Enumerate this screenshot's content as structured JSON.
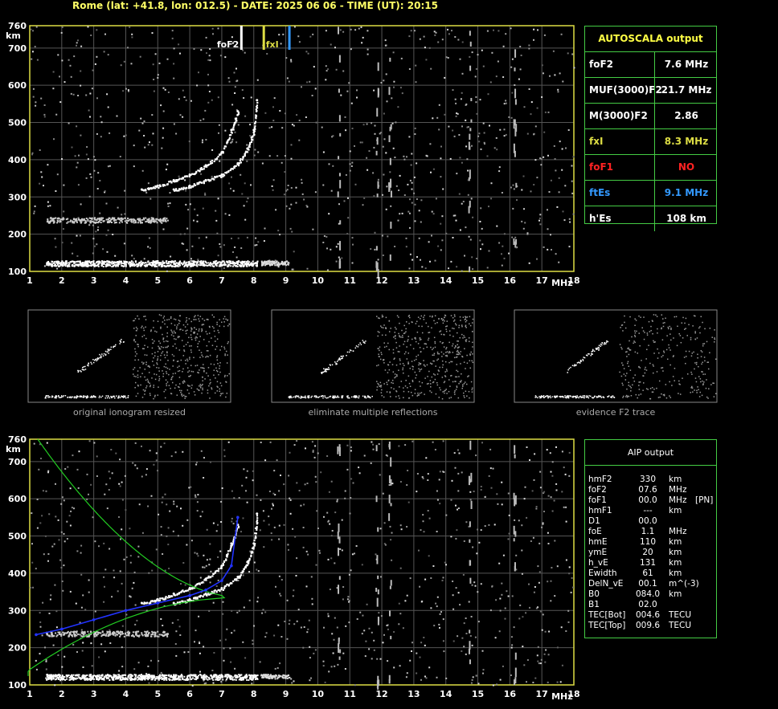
{
  "header": "Rome (lat: +41.8, lon: 012.5) - DATE: 2025 06 06 - TIME (UT): 20:15",
  "axis": {
    "y_unit": "km",
    "x_unit": "MHz",
    "y_ticks": [
      "760",
      "700",
      "600",
      "500",
      "400",
      "300",
      "200",
      "100"
    ],
    "x_ticks": [
      "1",
      "2",
      "3",
      "4",
      "5",
      "6",
      "7",
      "8",
      "9",
      "10",
      "11",
      "12",
      "13",
      "14",
      "15",
      "16",
      "17",
      "18"
    ]
  },
  "markers": {
    "fof2": "foF2",
    "fxi": "fxI",
    "ftes": "ftEs"
  },
  "autoscala": {
    "title": "AUTOSCALA output",
    "rows": [
      {
        "label": "foF2",
        "value": "7.6 MHz",
        "color": "#ffffff"
      },
      {
        "label": "MUF(3000)F2",
        "value": "21.7 MHz",
        "color": "#ffffff"
      },
      {
        "label": "M(3000)F2",
        "value": "2.86",
        "color": "#ffffff"
      },
      {
        "label": "fxI",
        "value": "8.3 MHz",
        "color": "#dddd44"
      },
      {
        "label": "foF1",
        "value": "NO",
        "color": "#ff2222"
      },
      {
        "label": "ftEs",
        "value": "9.1 MHz",
        "color": "#3399ff"
      },
      {
        "label": "h'Es",
        "value": "108    km",
        "color": "#ffffff"
      }
    ]
  },
  "thumbs": [
    {
      "caption": "original ionogram resized"
    },
    {
      "caption": "eliminate multiple reflections"
    },
    {
      "caption": "evidence F2 trace"
    }
  ],
  "aip": {
    "title": "AIP output",
    "rows": [
      [
        "hmF2",
        "330",
        "km",
        ""
      ],
      [
        "foF2",
        "07.6",
        "MHz",
        ""
      ],
      [
        "foF1",
        "00.0",
        "MHz",
        "[PN]"
      ],
      [
        "hmF1",
        "---",
        "km",
        ""
      ],
      [
        "D1",
        "00.0",
        "",
        ""
      ],
      [
        "foE",
        "1.1",
        "MHz",
        ""
      ],
      [
        "hmE",
        "110",
        "km",
        ""
      ],
      [
        "ymE",
        "20",
        "km",
        ""
      ],
      [
        "h_vE",
        "131",
        "km",
        ""
      ],
      [
        "Ewidth",
        "61",
        "km",
        ""
      ],
      [
        "DelN_vE",
        "00.1",
        "m^(-3)",
        ""
      ],
      [
        "B0",
        "084.0",
        "km",
        ""
      ],
      [
        "B1",
        "02.0",
        "",
        ""
      ],
      [
        "TEC[Bot]",
        "004.6",
        "TECU",
        ""
      ],
      [
        "TEC[Top]",
        "009.6",
        "TECU",
        ""
      ]
    ]
  },
  "chart_data": [
    {
      "type": "scatter",
      "title": "Rome (lat: +41.8, lon: 012.5) - DATE: 2025 06 06 - TIME (UT): 20:15",
      "xlabel": "MHz",
      "ylabel": "km",
      "xlim": [
        1,
        18
      ],
      "ylim": [
        100,
        760
      ],
      "grid": true,
      "series": [
        {
          "name": "",
          "x": [
            4.5,
            5.0,
            5.5,
            6.0,
            6.5,
            7.0,
            7.3,
            7.5
          ],
          "y": [
            320,
            330,
            345,
            360,
            385,
            420,
            480,
            530
          ]
        },
        {
          "name": "",
          "x": [
            5.5,
            6.0,
            6.5,
            7.0,
            7.5,
            7.8,
            8.0,
            8.1
          ],
          "y": [
            320,
            330,
            345,
            360,
            390,
            430,
            480,
            560
          ]
        }
      ]
    },
    {
      "type": "line",
      "xlabel": "MHz",
      "ylabel": "km",
      "xlim": [
        1,
        18
      ],
      "ylim": [
        100,
        760
      ],
      "grid": true,
      "series": [
        {
          "name": "",
          "x": [
            1.2,
            2,
            3,
            4,
            5,
            6,
            6.5,
            7,
            7.3,
            7.5
          ],
          "y": [
            235,
            250,
            275,
            300,
            320,
            340,
            355,
            380,
            420,
            550
          ]
        }
      ]
    }
  ]
}
